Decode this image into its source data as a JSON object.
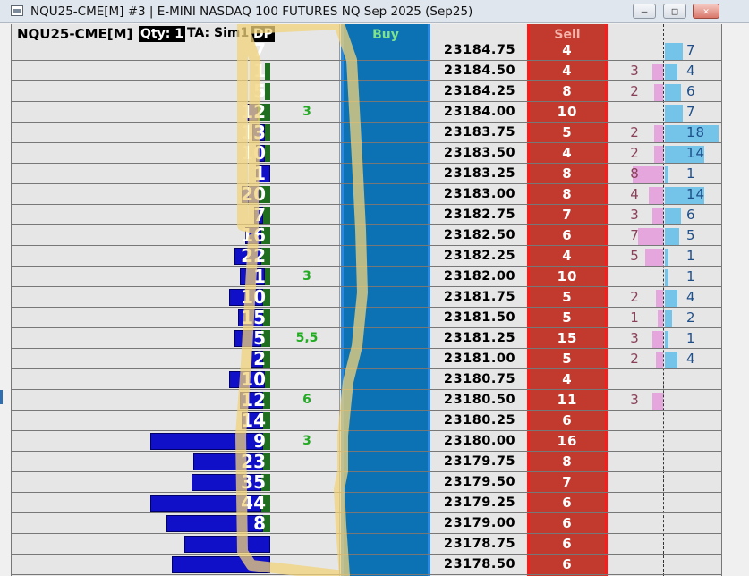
{
  "window": {
    "title": "NQU25-CME[M] #3 | E-MINI NASDAQ 100 FUTURES NQ Sep 2025 (Sep25)",
    "buttons": [
      "minimize",
      "maximize",
      "close"
    ]
  },
  "header": {
    "symbol": "NQU25-CME[M]",
    "qty": "Qty: 1",
    "ta": "TA: Sim1",
    "dp": "DP",
    "buy_label": "Buy",
    "sell_label": "Sell"
  },
  "colors": {
    "buy_column": "#0c72b4",
    "sell_column": "#c23a2e",
    "volume_bar": "#1010c8",
    "delta_bar": "#1f6e1f",
    "dp_text": "#22aa22",
    "annotation": "#f1d37a"
  },
  "ladder": [
    {
      "price": "23184.75",
      "vol": "7",
      "dp": "",
      "sell": "4",
      "bid": "",
      "ask": "7",
      "volw": 0,
      "dw": 0,
      "bidw": 0,
      "askw": 20
    },
    {
      "price": "23184.50",
      "vol": "1",
      "dp": "",
      "sell": "4",
      "bid": "3",
      "ask": "4",
      "volw": 0,
      "dw": 6,
      "bidw": 12,
      "askw": 14
    },
    {
      "price": "23184.25",
      "vol": "5",
      "dp": "",
      "sell": "8",
      "bid": "2",
      "ask": "6",
      "volw": 0,
      "dw": 6,
      "bidw": 10,
      "askw": 18
    },
    {
      "price": "23184.00",
      "vol": "12",
      "dp": "3",
      "sell": "10",
      "bid": "",
      "ask": "7",
      "volw": 12,
      "dw": 14,
      "bidw": 0,
      "askw": 20
    },
    {
      "price": "23183.75",
      "vol": "13",
      "dp": "",
      "sell": "5",
      "bid": "2",
      "ask": "18",
      "volw": 14,
      "dw": 6,
      "bidw": 10,
      "askw": 60
    },
    {
      "price": "23183.50",
      "vol": "10",
      "dp": "",
      "sell": "4",
      "bid": "2",
      "ask": "14",
      "volw": 10,
      "dw": 6,
      "bidw": 10,
      "askw": 44
    },
    {
      "price": "23183.25",
      "vol": "1",
      "dp": "",
      "sell": "8",
      "bid": "8",
      "ask": "1",
      "volw": 16,
      "dw": 0,
      "bidw": 34,
      "askw": 4
    },
    {
      "price": "23183.00",
      "vol": "20",
      "dp": "",
      "sell": "8",
      "bid": "4",
      "ask": "14",
      "volw": 20,
      "dw": 12,
      "bidw": 16,
      "askw": 44
    },
    {
      "price": "23182.75",
      "vol": "7",
      "dp": "",
      "sell": "7",
      "bid": "3",
      "ask": "6",
      "volw": 10,
      "dw": 8,
      "bidw": 12,
      "askw": 18
    },
    {
      "price": "23182.50",
      "vol": "16",
      "dp": "",
      "sell": "6",
      "bid": "7",
      "ask": "5",
      "volw": 18,
      "dw": 10,
      "bidw": 28,
      "askw": 16
    },
    {
      "price": "23182.25",
      "vol": "22",
      "dp": "",
      "sell": "4",
      "bid": "5",
      "ask": "1",
      "volw": 30,
      "dw": 10,
      "bidw": 20,
      "askw": 4
    },
    {
      "price": "23182.00",
      "vol": "1",
      "dp": "3",
      "sell": "10",
      "bid": "",
      "ask": "1",
      "volw": 28,
      "dw": 6,
      "bidw": 0,
      "askw": 4
    },
    {
      "price": "23181.75",
      "vol": "10",
      "dp": "",
      "sell": "5",
      "bid": "2",
      "ask": "4",
      "volw": 38,
      "dw": 8,
      "bidw": 8,
      "askw": 14
    },
    {
      "price": "23181.50",
      "vol": "15",
      "dp": "",
      "sell": "5",
      "bid": "1",
      "ask": "2",
      "volw": 28,
      "dw": 8,
      "bidw": 6,
      "askw": 8
    },
    {
      "price": "23181.25",
      "vol": "5",
      "dp": "5,5",
      "sell": "15",
      "bid": "3",
      "ask": "1",
      "volw": 30,
      "dw": 10,
      "bidw": 12,
      "askw": 4
    },
    {
      "price": "23181.00",
      "vol": "2",
      "dp": "",
      "sell": "5",
      "bid": "2",
      "ask": "4",
      "volw": 14,
      "dw": 8,
      "bidw": 8,
      "askw": 14
    },
    {
      "price": "23180.75",
      "vol": "10",
      "dp": "",
      "sell": "4",
      "bid": "",
      "ask": "",
      "volw": 40,
      "dw": 6,
      "bidw": 0,
      "askw": 0
    },
    {
      "price": "23180.50",
      "vol": "12",
      "dp": "6",
      "sell": "11",
      "bid": "3",
      "ask": "",
      "volw": 26,
      "dw": 8,
      "bidw": 12,
      "askw": 0
    },
    {
      "price": "23180.25",
      "vol": "14",
      "dp": "",
      "sell": "6",
      "bid": "",
      "ask": "",
      "volw": 24,
      "dw": 8,
      "bidw": 0,
      "askw": 0
    },
    {
      "price": "23180.00",
      "vol": "9",
      "dp": "3",
      "sell": "16",
      "bid": "",
      "ask": "",
      "volw": 126,
      "dw": 8,
      "bidw": 0,
      "askw": 0
    },
    {
      "price": "23179.75",
      "vol": "23",
      "dp": "",
      "sell": "8",
      "bid": "",
      "ask": "",
      "volw": 78,
      "dw": 8,
      "bidw": 0,
      "askw": 0
    },
    {
      "price": "23179.50",
      "vol": "35",
      "dp": "",
      "sell": "7",
      "bid": "",
      "ask": "",
      "volw": 78,
      "dw": 10,
      "bidw": 0,
      "askw": 0
    },
    {
      "price": "23179.25",
      "vol": "44",
      "dp": "",
      "sell": "6",
      "bid": "",
      "ask": "",
      "volw": 124,
      "dw": 10,
      "bidw": 0,
      "askw": 0
    },
    {
      "price": "23179.00",
      "vol": "8",
      "dp": "",
      "sell": "6",
      "bid": "",
      "ask": "",
      "volw": 108,
      "dw": 8,
      "bidw": 0,
      "askw": 0
    },
    {
      "price": "23178.75",
      "vol": "",
      "dp": "",
      "sell": "6",
      "bid": "",
      "ask": "",
      "volw": 96,
      "dw": 0,
      "bidw": 0,
      "askw": 0
    },
    {
      "price": "23178.50",
      "vol": "",
      "dp": "",
      "sell": "6",
      "bid": "",
      "ask": "",
      "volw": 110,
      "dw": 0,
      "bidw": 0,
      "askw": 0
    }
  ]
}
